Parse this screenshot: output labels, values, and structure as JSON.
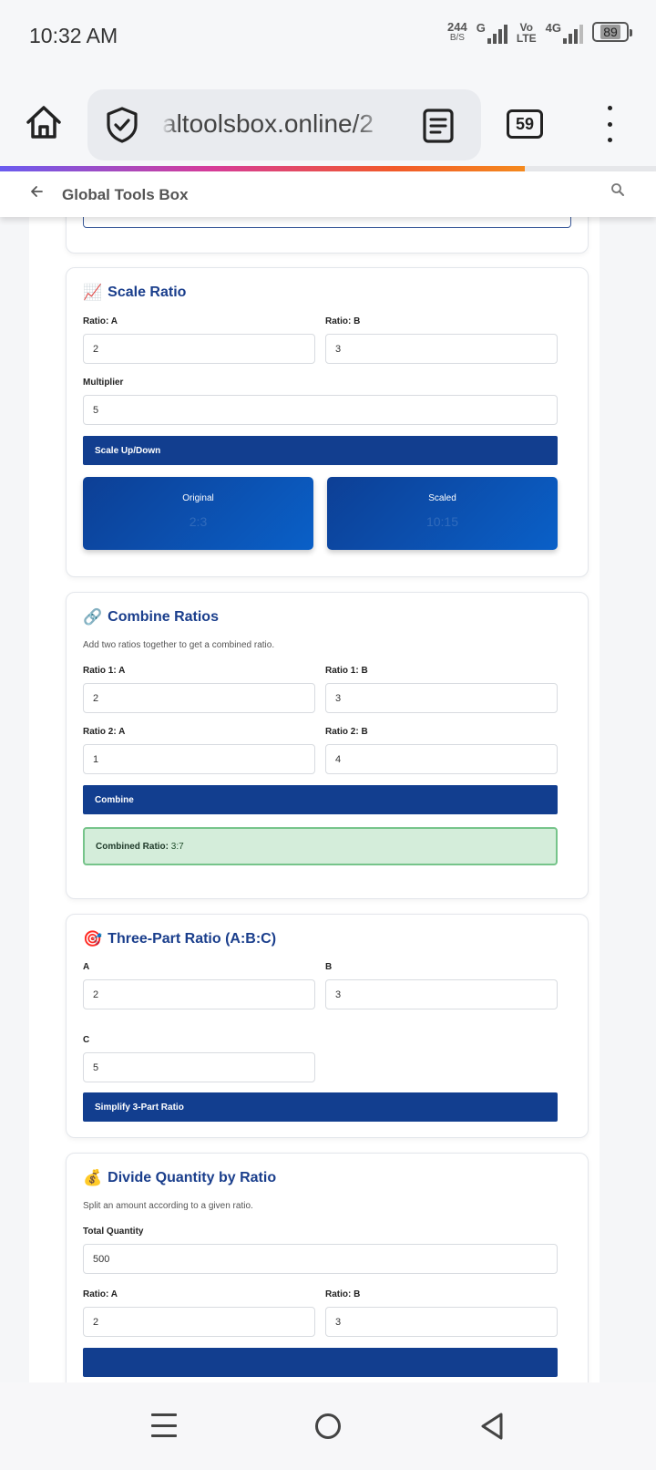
{
  "status_bar": {
    "time": "10:32 AM",
    "speed_value": "244",
    "speed_unit": "B/S",
    "net_g": "G",
    "volte_1": "Vo",
    "volte_2": "LTE",
    "net_4g": "4G",
    "battery": "89"
  },
  "browser": {
    "url": "altoolsbox.online/2",
    "tab_count": "59",
    "load_progress": 0.8
  },
  "page_header": {
    "back_icon": "arrow-left-icon",
    "title": "Global Tools Box",
    "search_icon": "search-icon"
  },
  "scale_ratio": {
    "emoji": "📈",
    "title": "Scale Ratio",
    "label_a": "Ratio: A",
    "label_b": "Ratio: B",
    "value_a": "2",
    "value_b": "3",
    "label_multiplier": "Multiplier",
    "value_multiplier": "5",
    "button": "Scale Up/Down",
    "original_label": "Original",
    "original_value": "2:3",
    "scaled_label": "Scaled",
    "scaled_value": "10:15"
  },
  "combine_ratios": {
    "emoji": "🔗",
    "title": "Combine Ratios",
    "description": "Add two ratios together to get a combined ratio.",
    "label_1a": "Ratio 1: A",
    "label_1b": "Ratio 1: B",
    "value_1a": "2",
    "value_1b": "3",
    "label_2a": "Ratio 2: A",
    "label_2b": "Ratio 2: B",
    "value_2a": "1",
    "value_2b": "4",
    "button": "Combine",
    "result_label": "Combined Ratio:",
    "result_value": "3:7"
  },
  "three_part": {
    "emoji": "🎯",
    "title": "Three-Part Ratio (A:B:C)",
    "label_a": "A",
    "label_b": "B",
    "label_c": "C",
    "value_a": "2",
    "value_b": "3",
    "value_c": "5",
    "button": "Simplify 3-Part Ratio"
  },
  "divide_quantity": {
    "emoji": "💰",
    "title": "Divide Quantity by Ratio",
    "description": "Split an amount according to a given ratio.",
    "label_total": "Total Quantity",
    "value_total": "500",
    "label_a": "Ratio: A",
    "label_b": "Ratio: B",
    "value_a": "2",
    "value_b": "3"
  },
  "nav_bar": {
    "menu_icon": "recent-apps-icon",
    "home_icon": "home-circle-icon",
    "back_icon": "back-triangle-icon"
  }
}
